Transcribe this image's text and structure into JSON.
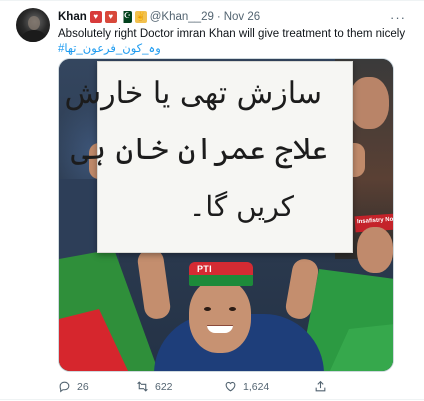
{
  "tweet": {
    "name": "Khan",
    "handle": "@Khan__29",
    "dot": "·",
    "date": "Nov 26",
    "more": "···",
    "text": "Absolutely right Doctor imran Khan will give treatment to them nicely",
    "hashtag": "#وہ_کون_فرعون_تھا"
  },
  "media": {
    "placard_lines": [
      "سازش تھی یا خارش",
      "علاج عمران خان ہی",
      "کریں گا۔"
    ],
    "cap_text": "PTI",
    "band_text": "Insafistry No"
  },
  "actions": {
    "reply_count": "26",
    "retweet_count": "622",
    "like_count": "1,624"
  },
  "colors": {
    "accent": "#1d9bf0",
    "muted": "#536471",
    "text": "#0f1419"
  },
  "icons": [
    "avatar",
    "heart-emoji",
    "pakistan-flag-emoji",
    "victory-hand-emoji",
    "more-icon",
    "reply-icon",
    "retweet-icon",
    "like-icon",
    "share-icon"
  ]
}
